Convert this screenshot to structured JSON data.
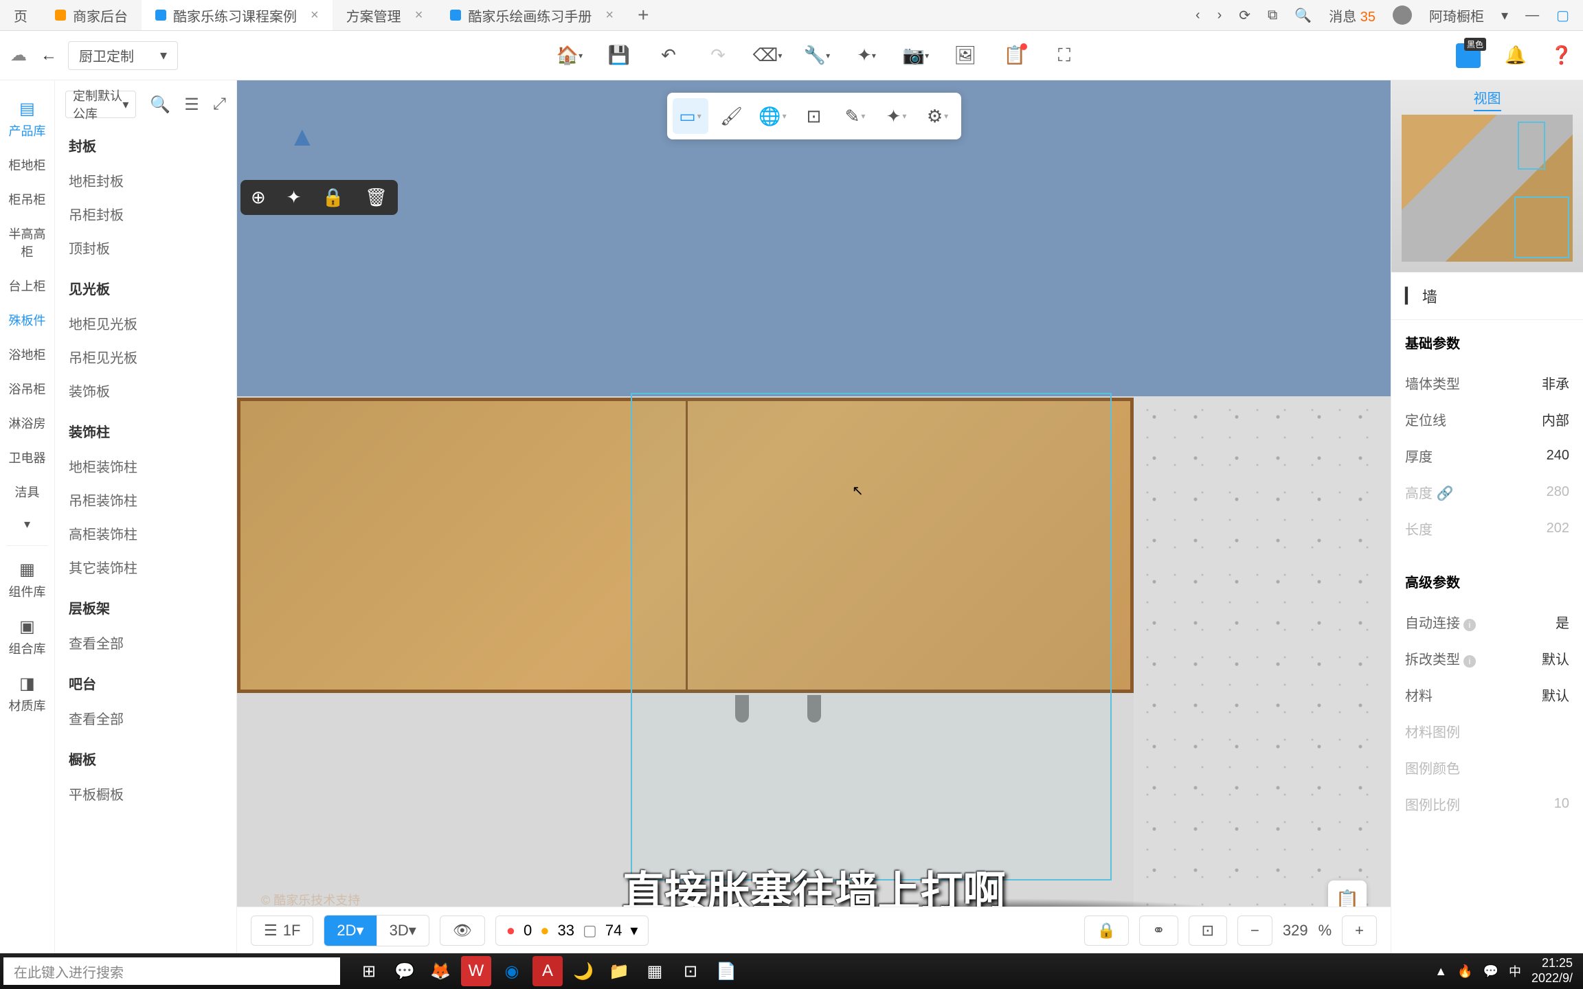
{
  "tabs": [
    {
      "label": "商家后台"
    },
    {
      "label": "酷家乐练习课程案例",
      "active": true
    },
    {
      "label": "方案管理"
    },
    {
      "label": "酷家乐绘画练习手册"
    }
  ],
  "browser_right": {
    "msg_label": "消息",
    "msg_count": "35",
    "user": "阿琦橱柜"
  },
  "category": "厨卫定制",
  "library": "定制默认公库",
  "rail": [
    {
      "label": "产品库",
      "active": true
    },
    {
      "label": "柜地柜"
    },
    {
      "label": "柜吊柜"
    },
    {
      "label": "半高高柜"
    },
    {
      "label": "台上柜"
    },
    {
      "label": "殊板件",
      "active": true
    },
    {
      "label": "浴地柜"
    },
    {
      "label": "浴吊柜"
    },
    {
      "label": "淋浴房"
    },
    {
      "label": "卫电器"
    },
    {
      "label": "洁具"
    }
  ],
  "rail_bottom": [
    {
      "label": "组件库"
    },
    {
      "label": "组合库"
    },
    {
      "label": "材质库"
    }
  ],
  "categories": [
    {
      "title": "封板",
      "items": [
        "地柜封板",
        "吊柜封板",
        "顶封板"
      ]
    },
    {
      "title": "见光板",
      "items": [
        "地柜见光板",
        "吊柜见光板",
        "装饰板"
      ]
    },
    {
      "title": "装饰柱",
      "items": [
        "地柜装饰柱",
        "吊柜装饰柱",
        "高柜装饰柱",
        "其它装饰柱"
      ]
    },
    {
      "title": "层板架",
      "items": [
        "查看全部"
      ]
    },
    {
      "title": "吧台",
      "items": [
        "查看全部"
      ]
    },
    {
      "title": "橱板",
      "items": [
        "平板橱板"
      ]
    }
  ],
  "subtitle": "直接胀塞往墙上打啊",
  "watermark": "© 酷家乐技术支持",
  "bottom": {
    "floor": "1F",
    "d2": "2D",
    "d3": "3D",
    "s0": "0",
    "s1": "33",
    "s2": "74",
    "zoom": "329",
    "pct": "%"
  },
  "right": {
    "view_tab": "视图",
    "wall": "墙",
    "sec1": "基础参数",
    "p1_l": "墙体类型",
    "p1_v": "非承",
    "p2_l": "定位线",
    "p2_v": "内部",
    "p3_l": "厚度",
    "p3_v": "240",
    "p4_l": "高度",
    "p4_v": "280",
    "p5_l": "长度",
    "p5_v": "202",
    "sec2": "高级参数",
    "p6_l": "自动连接",
    "p6_v": "是",
    "p7_l": "拆改类型",
    "p7_v": "默认",
    "p8_l": "材料",
    "p8_v": "默认",
    "p9_l": "材料图例",
    "p10_l": "图例颜色",
    "p11_l": "图例比例",
    "p11_v": "10"
  },
  "taskbar": {
    "search": "在此键入进行搜索",
    "time": "21:25",
    "date": "2022/9/",
    "ime": "中"
  }
}
